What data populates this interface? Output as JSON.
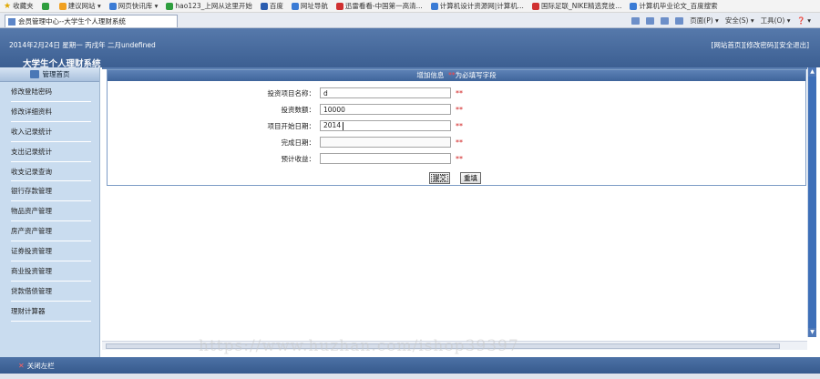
{
  "browser": {
    "favorites": [
      {
        "label": "收藏夹",
        "icon": "star-icon"
      },
      {
        "label": "",
        "icon": "add-favorite-icon"
      },
      {
        "label": "建议网站 ▾",
        "icon": "suggested-sites-icon"
      },
      {
        "label": "网页快讯库 ▾",
        "icon": "web-slice-icon"
      },
      {
        "label": "hao123_上网从这里开始",
        "icon": "hao123-icon"
      },
      {
        "label": "百度",
        "icon": "baidu-icon"
      },
      {
        "label": "网址导航",
        "icon": "nav-site-icon"
      },
      {
        "label": "迅雷看看-中国第一高清...",
        "icon": "xunlei-icon"
      },
      {
        "label": "计算机设计资源网|计算机...",
        "icon": "page-icon"
      },
      {
        "label": "国际足联_NIKE精选竞技...",
        "icon": "fifa-icon"
      },
      {
        "label": "计算机毕业论文_百度搜索",
        "icon": "page-icon"
      }
    ],
    "tab_title": "会员管理中心--大学生个人理财系统",
    "toolbar": {
      "page": "页面(P) ▾",
      "safety": "安全(S) ▾",
      "tools": "工具(O) ▾",
      "help": "❓ ▾"
    }
  },
  "header": {
    "date_text": "2014年2月24日 星期一 丙戌年 二月undefined",
    "links": [
      "[网站首页]",
      "[修改密码]",
      "[安全退出]"
    ],
    "app_title": "大学生个人理财系统"
  },
  "sidebar": {
    "home_label": "管理首页",
    "items": [
      {
        "label": "修改登陆密码"
      },
      {
        "label": "修改详细资料"
      },
      {
        "label": "收入记录统计"
      },
      {
        "label": "支出记录统计"
      },
      {
        "label": "收支记录查询"
      },
      {
        "label": "银行存款管理"
      },
      {
        "label": "物品资产管理"
      },
      {
        "label": "房产资产管理"
      },
      {
        "label": "证券投资管理"
      },
      {
        "label": "商业投资管理"
      },
      {
        "label": "贷款借债管理"
      },
      {
        "label": "理财计算器"
      }
    ]
  },
  "form": {
    "heading": "增加信息",
    "required_mark": "**",
    "required_note": "为必填写字段",
    "fields": [
      {
        "label": "投资项目名称：",
        "value": "d"
      },
      {
        "label": "投资数额：",
        "value": "10000"
      },
      {
        "label": "项目开始日期：",
        "value": "2014"
      },
      {
        "label": "完成日期：",
        "value": ""
      },
      {
        "label": "预计收益：",
        "value": ""
      }
    ],
    "submit_label": "提交",
    "reset_label": "重填"
  },
  "footer": {
    "close_label": "关闭左栏"
  },
  "watermark": "https://www.huzhan.com/ishop39397",
  "colors": {
    "header_blue": "#4a6fa3",
    "sidebar_bg": "#c9dcef",
    "required_red": "#d01a1a"
  }
}
